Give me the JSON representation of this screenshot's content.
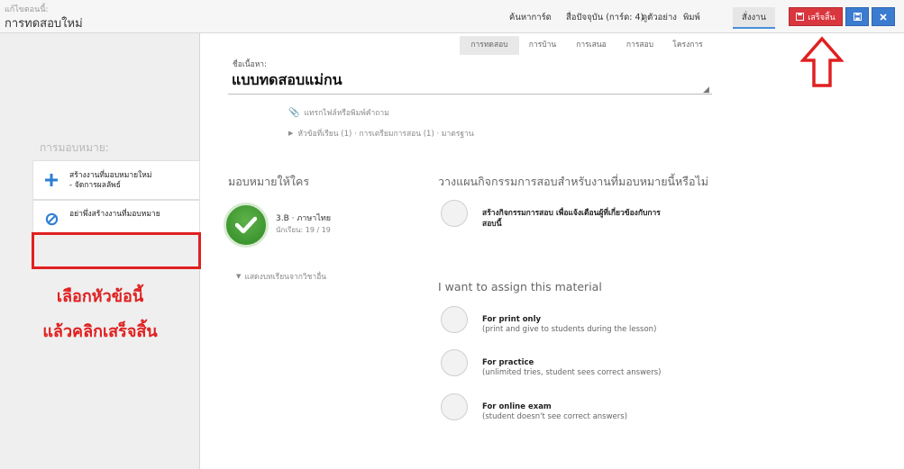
{
  "header": {
    "editing_label": "แก้ไขตอนนี้:",
    "title": "การทดสอบใหม่",
    "nav": [
      "ค้นหาการ์ด",
      "สื่อปัจจุบัน (การ์ด: 4)",
      "ดูตัวอย่าง",
      "พิมพ์",
      "สั่งงาน"
    ],
    "finish_label": "เสร็จสิ้น"
  },
  "subtabs": [
    "การทดสอบ",
    "การบ้าน",
    "การเสนอ",
    "การสอบ",
    "โครงการ"
  ],
  "subject": {
    "label": "ชื่อเนื้อหา:",
    "value": "แบบทดสอบแม่กน"
  },
  "attach_text": "แทรกไฟล์หรือพิมพ์คำถาม",
  "topic_text": "หัวข้อที่เรียน (1) · การเตรียมการสอน (1) · มาตรฐาน",
  "left": {
    "heading": "การมอบหมาย:",
    "option1_line1": "สร้างงานที่มอบหมายใหม่",
    "option1_line2": "- จัดการผลลัพธ์",
    "option2": "อย่าพึ่งสร้างงานที่มอบหมาย",
    "instruction_line1": "เลือกหัวข้อนี้",
    "instruction_line2": "แล้วคลิกเสร็จสิ้น"
  },
  "assign_to": {
    "title": "มอบหมายให้ใคร",
    "class_name": "3.B · ภาษาไทย",
    "students": "นักเรียน: 19 / 19",
    "show_other": "แสดงบทเรียนจากวิชาอื่น"
  },
  "plan": {
    "title": "วางแผนกิจกรรมการสอบสำหรับงานที่มอบหมายนี้หรือไม่",
    "option_line1": "สร้างกิจกรรมการสอบ เพื่อแจ้งเตือนผู้ที่เกี่ยวข้องกับการ",
    "option_line2": "สอบนี้"
  },
  "material": {
    "title": "I want to assign this material",
    "options": [
      {
        "label": "For print only",
        "sub": "(print and give to students during the lesson)"
      },
      {
        "label": "For practice",
        "sub": "(unlimited tries, student sees correct answers)"
      },
      {
        "label": "For online exam",
        "sub": "(student doesn't see correct answers)"
      }
    ]
  },
  "colors": {
    "accent_red": "#d9363e",
    "accent_blue": "#3b7bd0",
    "annotation_red": "#e02020",
    "class_green": "#3a9a2e"
  }
}
